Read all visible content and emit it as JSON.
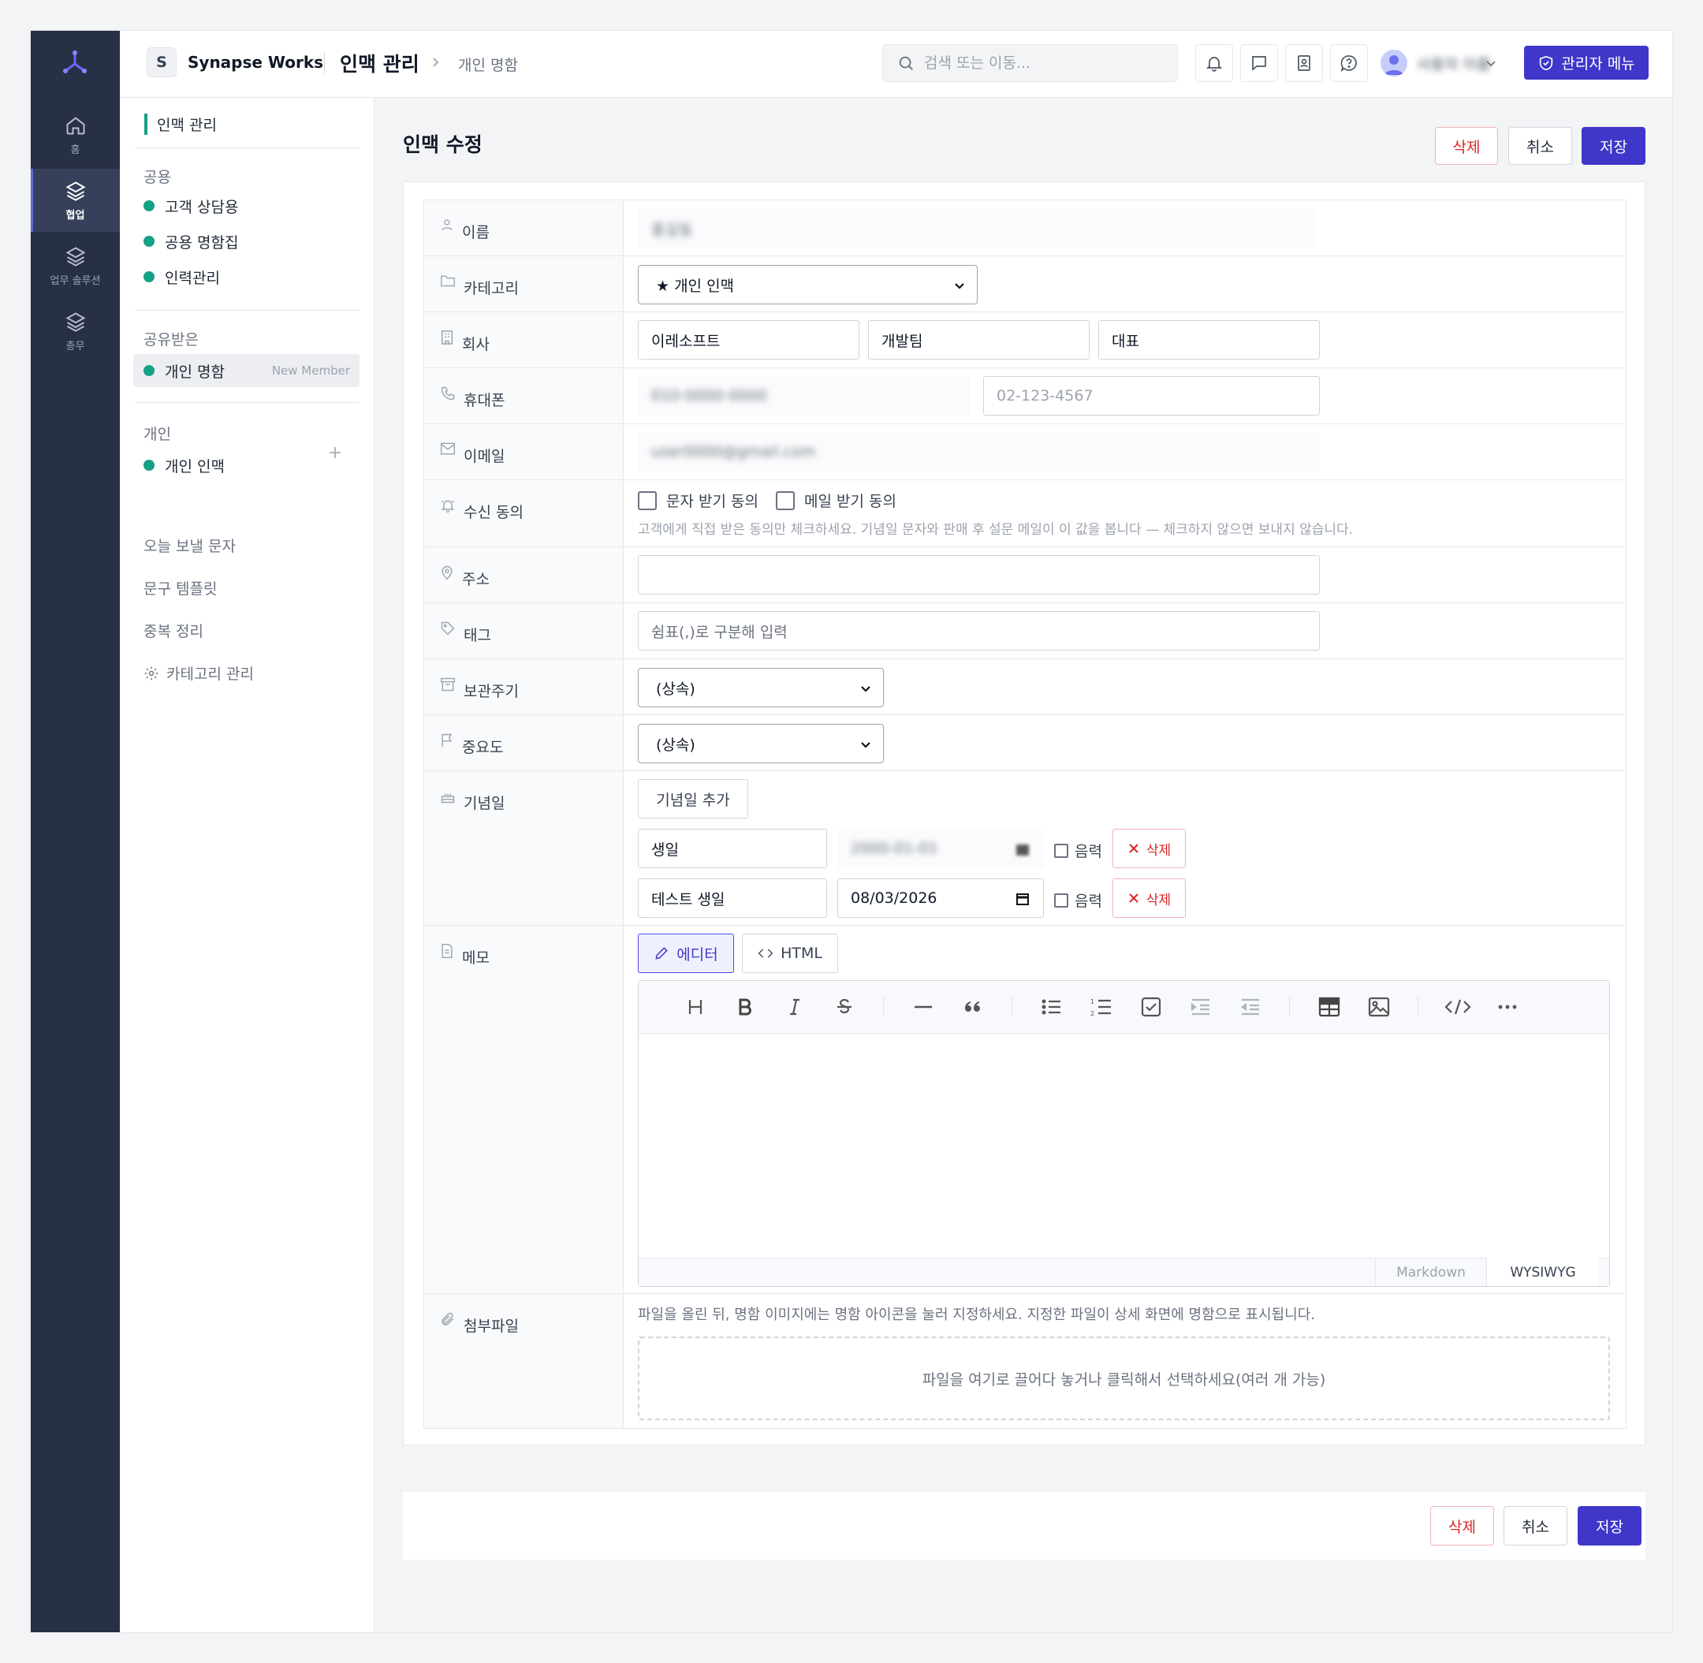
{
  "rail": {
    "items": [
      {
        "label": "홈",
        "icon": "home-icon"
      },
      {
        "label": "협업",
        "icon": "layers-icon",
        "active": true
      },
      {
        "label": "업무 솔루션",
        "icon": "layers-icon"
      },
      {
        "label": "총무",
        "icon": "layers-icon"
      }
    ]
  },
  "header": {
    "org_initial": "S",
    "org_name": "Synapse Works",
    "page_title": "인맥 관리",
    "breadcrumb": "개인 명함",
    "search_placeholder": "검색 또는 이동...",
    "user_name": "사용자 이름",
    "admin_label": "관리자 메뉴"
  },
  "sidebar": {
    "title": "인맥 관리",
    "groups": {
      "shared": "공용",
      "received": "공유받은",
      "personal": "개인"
    },
    "shared_items": [
      "고객 상담용",
      "공용 명함집",
      "인력관리"
    ],
    "received_item": {
      "label": "개인 명함",
      "tag": "New Member"
    },
    "personal_item": "개인 인맥",
    "links": [
      "오늘 보낼 문자",
      "문구 템플릿",
      "중복 정리",
      "카테고리 관리"
    ]
  },
  "form": {
    "title": "인맥 수정",
    "buttons": {
      "delete": "삭제",
      "cancel": "취소",
      "save": "저장"
    },
    "labels": {
      "name": "이름",
      "category": "카테고리",
      "company": "회사",
      "phone": "휴대폰",
      "email": "이메일",
      "consent": "수신 동의",
      "address": "주소",
      "tags": "태그",
      "retention": "보관주기",
      "importance": "중요도",
      "anniversary": "기념일",
      "memo": "메모",
      "attachment": "첨부파일"
    },
    "values": {
      "name": "홍길동",
      "category": "★ 개인 인맥",
      "company": "이레소프트",
      "department": "개발팀",
      "position": "대표",
      "mobile": "010-0000-0000",
      "phone_placeholder": "02-123-4567",
      "email": "user0000@gmail.com",
      "address": "",
      "tags_placeholder": "쉼표(,)로 구분해 입력",
      "retention": "(상속)",
      "importance": "(상속)"
    },
    "consent": {
      "sms": "문자 받기 동의",
      "mail": "메일 받기 동의",
      "hint": "고객에게 직접 받은 동의만 체크하세요. 기념일 문자와 판매 후 설문 메일이 이 값을 봅니다 — 체크하지 않으면 보내지 않습니다."
    },
    "anniversary": {
      "add_label": "기념일 추가",
      "lunar_label": "음력",
      "delete_label": "삭제",
      "entries": [
        {
          "name": "생일",
          "date": "2000-01-01"
        },
        {
          "name": "테스트 생일",
          "date": "08/03/2026"
        }
      ]
    },
    "memo": {
      "tab_editor": "에디터",
      "tab_html": "HTML",
      "mode_markdown": "Markdown",
      "mode_wysiwyg": "WYSIWYG",
      "toolbar": [
        "heading-icon",
        "bold-icon",
        "italic-icon",
        "strike-icon",
        "hr-icon",
        "quote-icon",
        "bullet-list-icon",
        "ordered-list-icon",
        "task-icon",
        "indent-icon",
        "outdent-icon",
        "table-icon",
        "image-icon",
        "code-icon",
        "more-icon"
      ]
    },
    "attachment": {
      "hint": "파일을 올린 뒤, 명함 이미지에는 명함 아이콘을 눌러 지정하세요. 지정한 파일이 상세 화면에 명함으로 표시됩니다.",
      "drop_text": "파일을 여기로 끌어다 놓거나 클릭해서 선택하세요(여러 개 가능)"
    }
  },
  "colors": {
    "primary": "#3f37c9",
    "rail": "#283046",
    "accent_dot": "#16a085",
    "danger": "#dc2626"
  }
}
